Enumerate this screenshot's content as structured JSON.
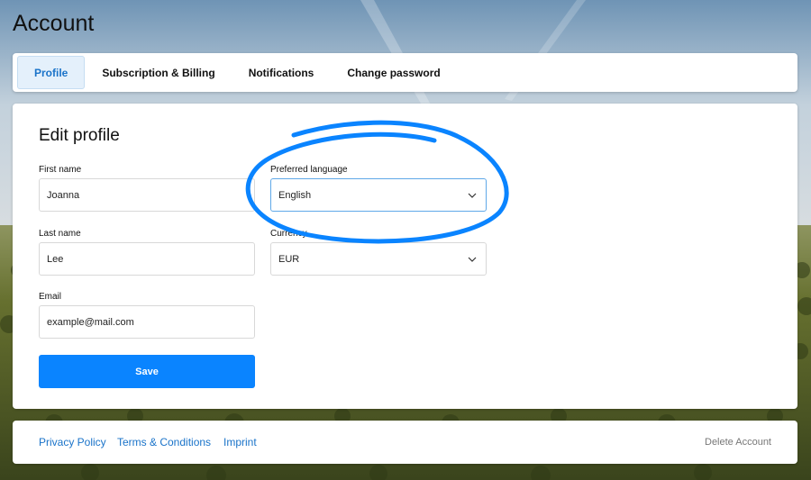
{
  "page": {
    "title": "Account"
  },
  "tabs": [
    {
      "label": "Profile",
      "active": true
    },
    {
      "label": "Subscription & Billing",
      "active": false
    },
    {
      "label": "Notifications",
      "active": false
    },
    {
      "label": "Change password",
      "active": false
    }
  ],
  "form": {
    "title": "Edit profile",
    "first_name": {
      "label": "First name",
      "value": "Joanna"
    },
    "last_name": {
      "label": "Last name",
      "value": "Lee"
    },
    "email": {
      "label": "Email",
      "value": "example@mail.com"
    },
    "preferred_language": {
      "label": "Preferred language",
      "value": "English"
    },
    "currency": {
      "label": "Currency",
      "value": "EUR"
    },
    "save_label": "Save"
  },
  "footer": {
    "links": [
      "Privacy Policy",
      "Terms & Conditions",
      "Imprint"
    ],
    "delete_label": "Delete Account"
  },
  "colors": {
    "accent": "#0a84ff",
    "link": "#1a73c9",
    "annotation": "#0a84ff"
  },
  "icons": {
    "dropdown": "chevron-down-icon"
  }
}
